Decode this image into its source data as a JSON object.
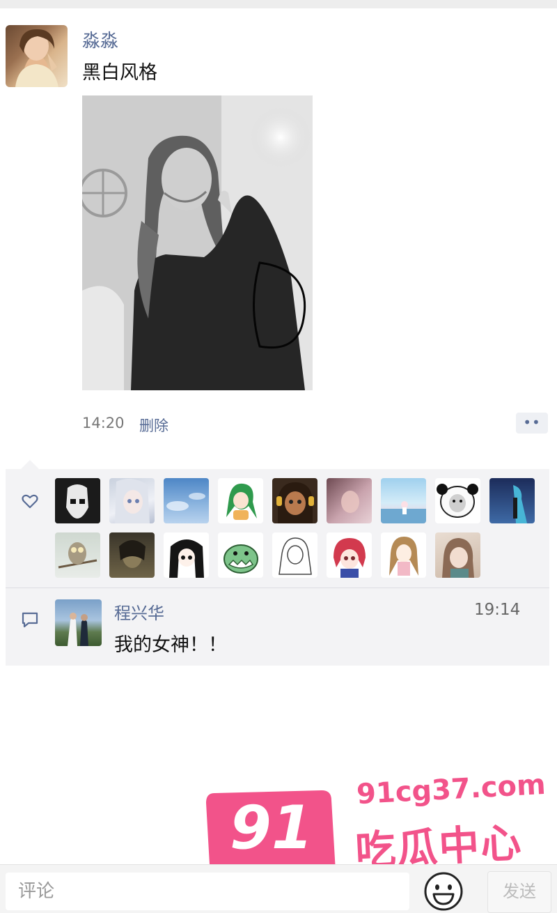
{
  "post": {
    "author": "淼淼",
    "text": "黑白风格",
    "time": "14:20",
    "delete_label": "删除",
    "more_label": "••"
  },
  "likes": {
    "icon": "heart-outline-icon",
    "avatars": [
      "stormtrooper",
      "anime-silver-hair",
      "blue-sky",
      "green-hair-cartoon",
      "cartoon-girl-headphones",
      "pink-photo",
      "anime-scenery",
      "panda-meme",
      "blue-hair-anime",
      "owl-winter",
      "dark-anime",
      "black-hair-anime",
      "green-dinosaur",
      "sketch-girl",
      "red-hair-anime",
      "brown-hair-anime",
      "girl-illustration"
    ]
  },
  "comment": {
    "icon": "comment-bubble-icon",
    "name": "程兴华",
    "time": "19:14",
    "text": "我的女神！！"
  },
  "input": {
    "placeholder": "评论",
    "send_label": "发送",
    "emoji_icon": "smiley-face-icon"
  },
  "watermark": {
    "number": "91",
    "url": "91cg37.com",
    "name": "吃瓜中心",
    "color": "#f2538a"
  },
  "colors": {
    "link": "#576b95",
    "panel": "#f3f3f5"
  }
}
